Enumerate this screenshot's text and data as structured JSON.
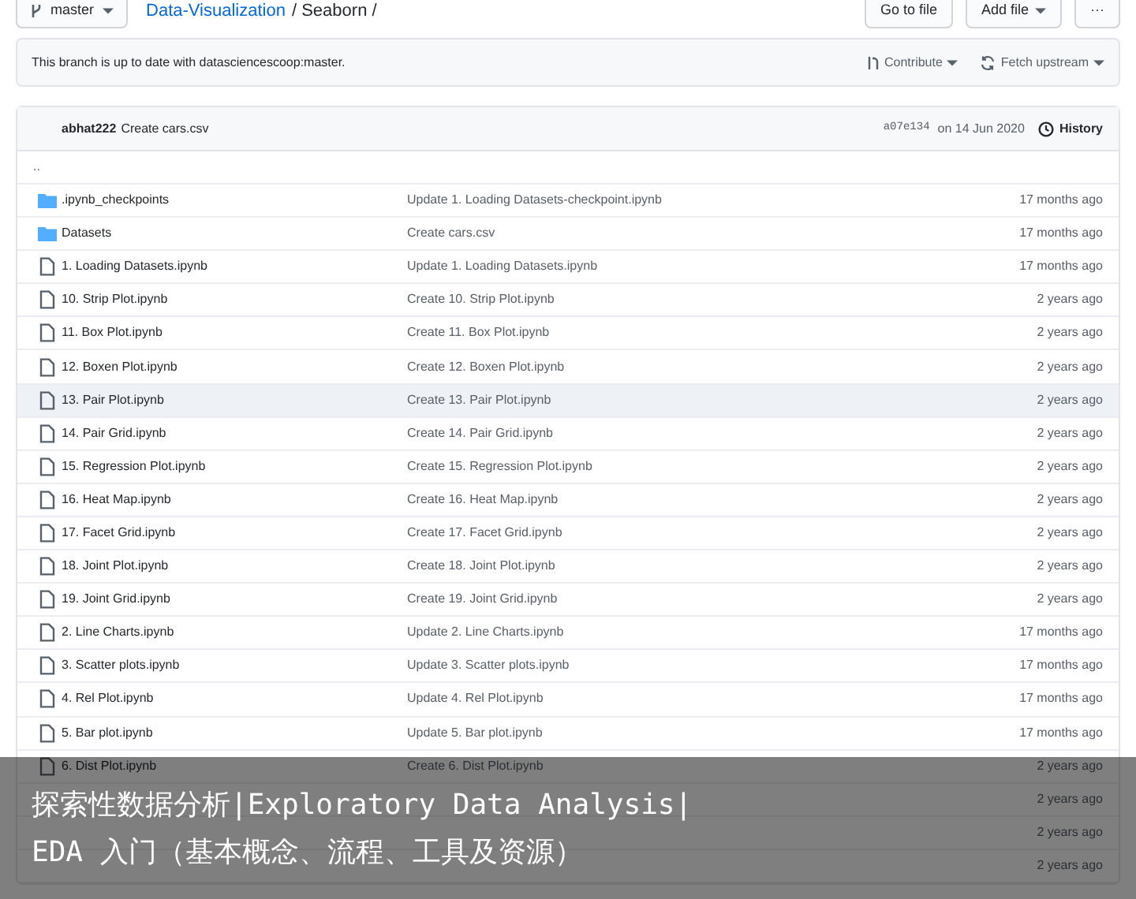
{
  "branch": "master",
  "breadcrumb": [
    {
      "text": "Data-Visualization",
      "kind": "link"
    },
    {
      "text": "/ Seaborn /",
      "kind": "plain"
    }
  ],
  "top_buttons": [
    {
      "label": "Go to file",
      "caret": false
    },
    {
      "label": "Add file",
      "caret": true
    },
    {
      "label": "···",
      "caret": false
    }
  ],
  "notice": {
    "text": "This branch is up to date with datasciencescoop:master.",
    "actions": [
      {
        "label": "Contribute",
        "kind": "pr"
      },
      {
        "label": "Fetch upstream",
        "kind": "sync"
      }
    ]
  },
  "commit": {
    "author": "abhat222",
    "message": "Create cars.csv",
    "sha": "a07e134",
    "date": "on 14 Jun 2020",
    "history": "History"
  },
  "parent_link": "..",
  "files": [
    {
      "kind": "folder",
      "name": ".ipynb_checkpoints",
      "message": "Update 1. Loading Datasets-checkpoint.ipynb",
      "age": "17 months ago",
      "highlighted": false
    },
    {
      "kind": "folder",
      "name": "Datasets",
      "message": "Create cars.csv",
      "age": "17 months ago",
      "highlighted": false
    },
    {
      "kind": "file",
      "name": "1. Loading Datasets.ipynb",
      "message": "Update 1. Loading Datasets.ipynb",
      "age": "17 months ago",
      "highlighted": false
    },
    {
      "kind": "file",
      "name": "10. Strip Plot.ipynb",
      "message": "Create 10. Strip Plot.ipynb",
      "age": "2 years ago",
      "highlighted": false
    },
    {
      "kind": "file",
      "name": "11. Box Plot.ipynb",
      "message": "Create 11. Box Plot.ipynb",
      "age": "2 years ago",
      "highlighted": false
    },
    {
      "kind": "file",
      "name": "12. Boxen Plot.ipynb",
      "message": "Create 12. Boxen Plot.ipynb",
      "age": "2 years ago",
      "highlighted": false
    },
    {
      "kind": "file",
      "name": "13. Pair Plot.ipynb",
      "message": "Create 13. Pair Plot.ipynb",
      "age": "2 years ago",
      "highlighted": true
    },
    {
      "kind": "file",
      "name": "14. Pair Grid.ipynb",
      "message": "Create 14. Pair Grid.ipynb",
      "age": "2 years ago",
      "highlighted": false
    },
    {
      "kind": "file",
      "name": "15. Regression Plot.ipynb",
      "message": "Create 15. Regression Plot.ipynb",
      "age": "2 years ago",
      "highlighted": false
    },
    {
      "kind": "file",
      "name": "16. Heat Map.ipynb",
      "message": "Create 16. Heat Map.ipynb",
      "age": "2 years ago",
      "highlighted": false
    },
    {
      "kind": "file",
      "name": "17. Facet Grid.ipynb",
      "message": "Create 17. Facet Grid.ipynb",
      "age": "2 years ago",
      "highlighted": false
    },
    {
      "kind": "file",
      "name": "18. Joint Plot.ipynb",
      "message": "Create 18. Joint Plot.ipynb",
      "age": "2 years ago",
      "highlighted": false
    },
    {
      "kind": "file",
      "name": "19. Joint Grid.ipynb",
      "message": "Create 19. Joint Grid.ipynb",
      "age": "2 years ago",
      "highlighted": false
    },
    {
      "kind": "file",
      "name": "2. Line Charts.ipynb",
      "message": "Update 2. Line Charts.ipynb",
      "age": "17 months ago",
      "highlighted": false
    },
    {
      "kind": "file",
      "name": "3. Scatter plots.ipynb",
      "message": "Update 3. Scatter plots.ipynb",
      "age": "17 months ago",
      "highlighted": false
    },
    {
      "kind": "file",
      "name": "4. Rel Plot.ipynb",
      "message": "Update 4. Rel Plot.ipynb",
      "age": "17 months ago",
      "highlighted": false
    },
    {
      "kind": "file",
      "name": "5. Bar plot.ipynb",
      "message": "Update 5. Bar plot.ipynb",
      "age": "17 months ago",
      "highlighted": false
    },
    {
      "kind": "file",
      "name": "6. Dist Plot.ipynb",
      "message": "Create 6. Dist Plot.ipynb",
      "age": "2 years ago",
      "highlighted": false
    },
    {
      "kind": "covered",
      "age": "2 years ago"
    },
    {
      "kind": "covered",
      "age": "2 years ago"
    },
    {
      "kind": "covered",
      "age": "2 years ago"
    }
  ],
  "caption": [
    "探索性数据分析|Exploratory Data Analysis|",
    "EDA 入门（基本概念、流程、工具及资源）"
  ]
}
